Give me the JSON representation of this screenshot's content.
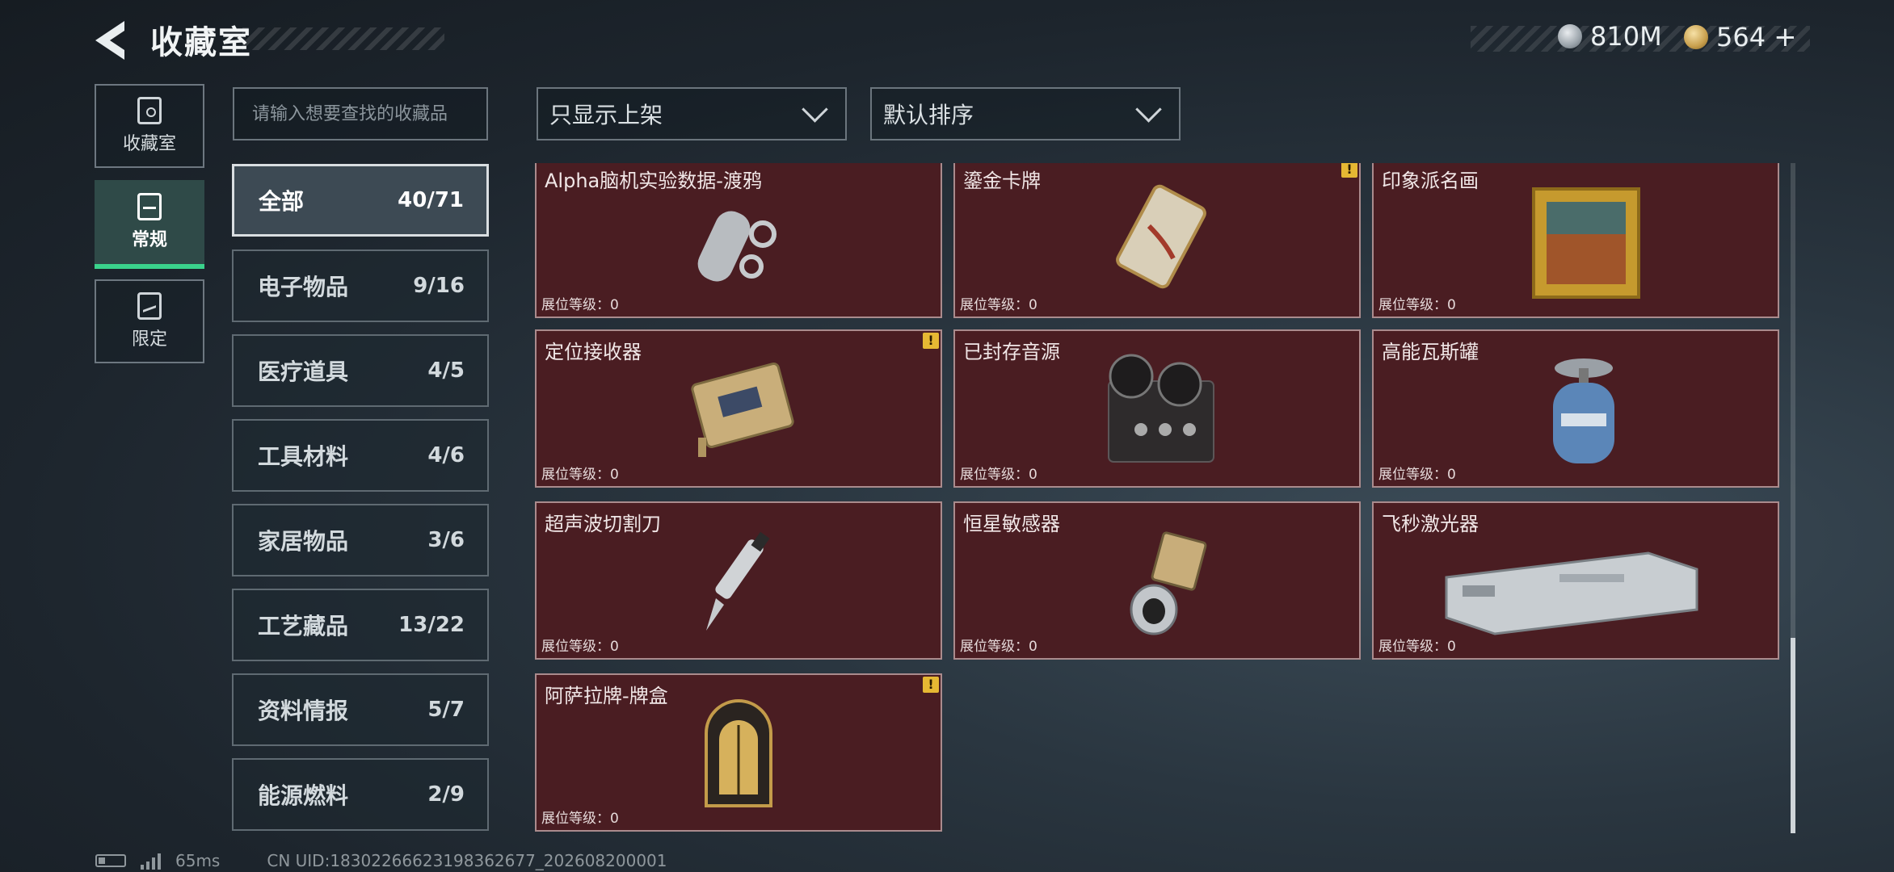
{
  "header": {
    "title": "收藏室",
    "currency": [
      {
        "icon": "silver-coin-icon",
        "value": "810M"
      },
      {
        "icon": "gold-coin-icon",
        "value": "564"
      }
    ],
    "add_symbol": "+"
  },
  "left_nav": [
    {
      "label": "收藏室",
      "icon": "collection-room-icon",
      "active": false
    },
    {
      "label": "常规",
      "icon": "regular-icon",
      "active": true
    },
    {
      "label": "限定",
      "icon": "limited-icon",
      "active": false
    }
  ],
  "search": {
    "placeholder": "请输入想要查找的收藏品"
  },
  "categories": [
    {
      "name": "全部",
      "count": "40/71"
    },
    {
      "name": "电子物品",
      "count": "9/16"
    },
    {
      "name": "医疗道具",
      "count": "4/5"
    },
    {
      "name": "工具材料",
      "count": "4/6"
    },
    {
      "name": "家居物品",
      "count": "3/6"
    },
    {
      "name": "工艺藏品",
      "count": "13/22"
    },
    {
      "name": "资料情报",
      "count": "5/7"
    },
    {
      "name": "能源燃料",
      "count": "2/9"
    }
  ],
  "filters": {
    "shelf_filter": "只显示上架",
    "sort": "默认排序"
  },
  "items": [
    {
      "name": "Alpha脑机实验数据-渡鸦",
      "level": "展位等级：0",
      "alert": false
    },
    {
      "name": "鎏金卡牌",
      "level": "展位等级：0",
      "alert": true
    },
    {
      "name": "印象派名画",
      "level": "展位等级：0",
      "alert": false
    },
    {
      "name": "定位接收器",
      "level": "展位等级：0",
      "alert": true
    },
    {
      "name": "已封存音源",
      "level": "展位等级：0",
      "alert": false
    },
    {
      "name": "高能瓦斯罐",
      "level": "展位等级：0",
      "alert": false
    },
    {
      "name": "超声波切割刀",
      "level": "展位等级：0",
      "alert": false
    },
    {
      "name": "恒星敏感器",
      "level": "展位等级：0",
      "alert": false
    },
    {
      "name": "飞秒激光器",
      "level": "展位等级：0",
      "alert": false
    },
    {
      "name": "阿萨拉牌-牌盒",
      "level": "展位等级：0",
      "alert": true
    }
  ],
  "footer": {
    "ping": "65ms",
    "uid": "CN UID:18302266623198362677_202608200001"
  },
  "colors": {
    "card_bg": "#4a1d22",
    "active_accent": "#3ad38c",
    "alert": "#e6b833"
  }
}
